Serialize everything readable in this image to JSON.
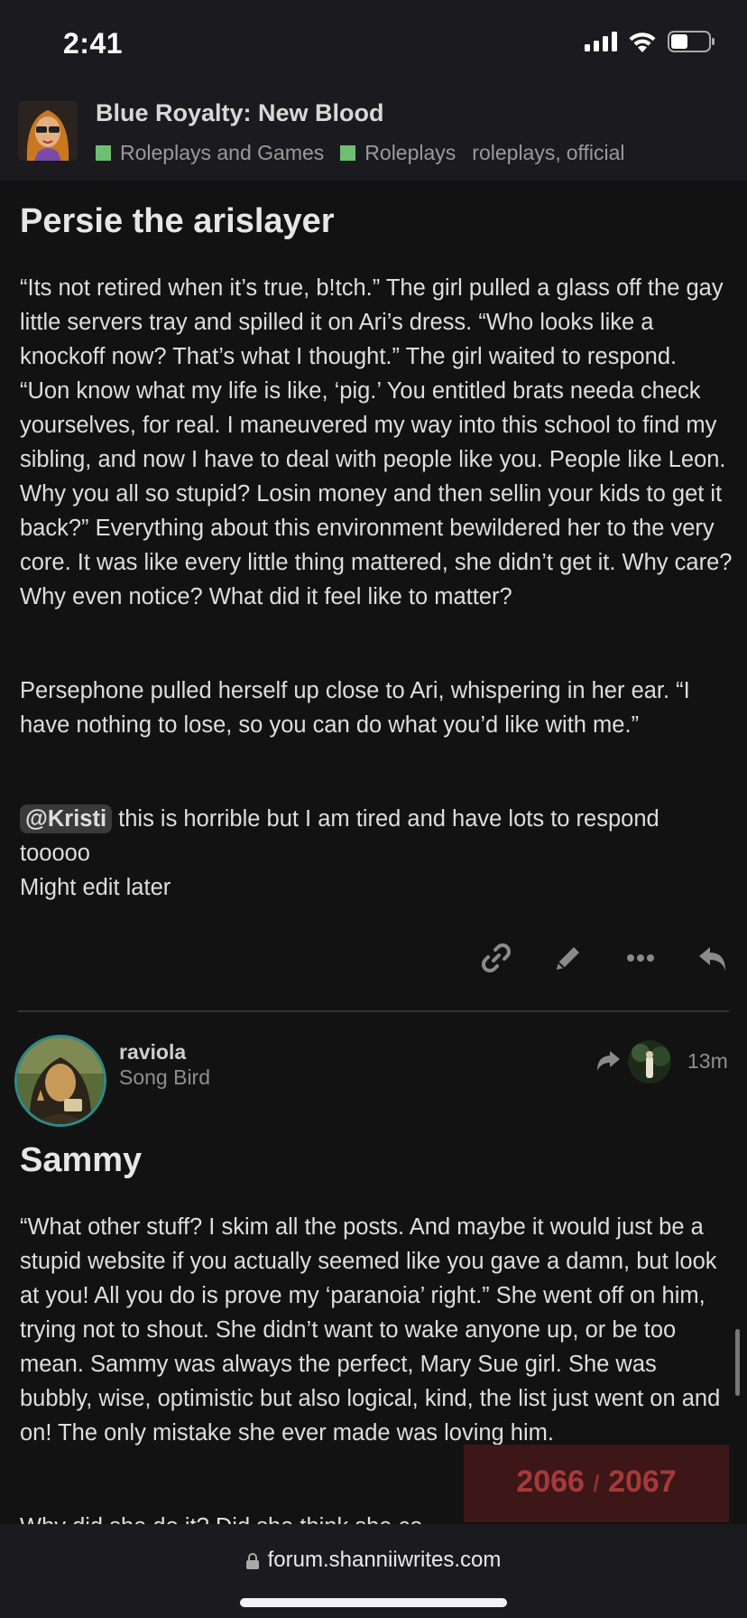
{
  "status_bar": {
    "time": "2:41",
    "battery_level": 0.45
  },
  "topic": {
    "title": "Blue Royalty: New Blood",
    "categories": [
      {
        "label": "Roleplays and Games",
        "color": "#6fbf73"
      },
      {
        "label": "Roleplays",
        "color": "#6fbf73"
      }
    ],
    "tags": [
      "roleplays,",
      "official"
    ]
  },
  "post1": {
    "heading": "Persie the arislayer",
    "paragraphs": [
      "“Its not retired when it’s true, b!tch.” The girl pulled a glass off the gay little servers tray and spilled it on Ari’s dress. “Who looks like a knockoff now? That’s what I thought.” The girl waited to respond. “Uon know what my life is like, ‘pig.’ You entitled brats needa check yourselves, for real. I maneuvered my way into this school to find my sibling, and now I have to deal with people like you. People like Leon. Why you all so stupid? Losin money and then sellin your kids to get it back?” Everything about this environment bewildered her to the very core. It was like every little thing mattered, she didn’t get it. Why care? Why even notice? What did it feel like to matter?",
      "Persephone pulled herself up close to Ari, whispering in her ear. “I have nothing to lose, so you can do what you’d like with me.”"
    ],
    "mention": "@Kristi",
    "mention_text": " this is horrible but I am tired and have lots to respond tooooo",
    "last_line": "Might edit later",
    "actions": [
      "link-icon",
      "pencil-icon",
      "more-icon",
      "reply-icon"
    ]
  },
  "post2": {
    "username": "raviola",
    "user_title": "Song Bird",
    "date": "13m",
    "heading": "Sammy",
    "paragraph": "“What other stuff? I skim all the posts. And maybe it would just be a stupid website if you actually seemed like you gave a damn, but look at you! All you do is prove my ‘paranoia’ right.” She went off on him, trying not to shout. She didn’t want to wake anyone up, or be too mean. Sammy was always the perfect, Mary Sue girl. She was bubbly, wise, optimistic but also logical, kind, the list just went on and on! The only mistake she ever made was loving him.",
    "cut_paragraph": "Why did she do it? Did she think she co"
  },
  "progress": {
    "current": "2066",
    "separator": "/",
    "total": "2067"
  },
  "url_bar": {
    "url": "forum.shanniiwrites.com"
  }
}
